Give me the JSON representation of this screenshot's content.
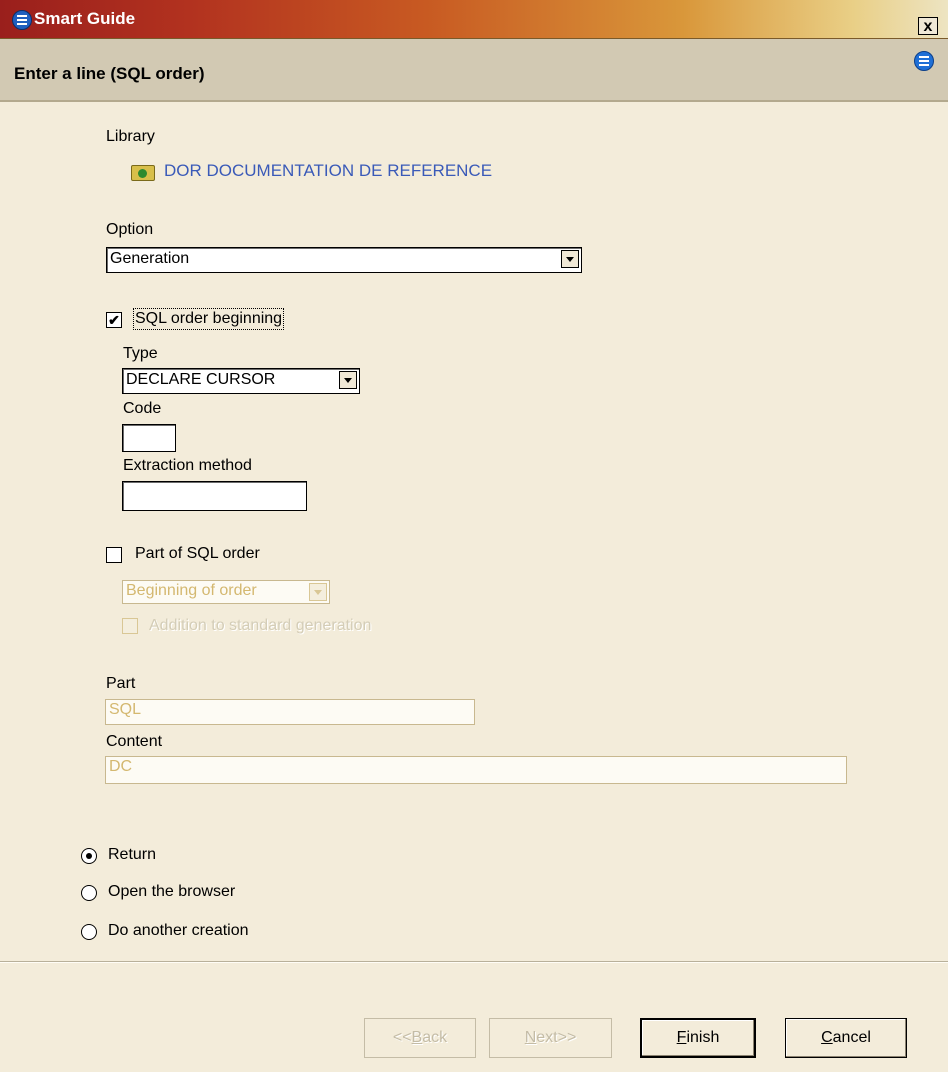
{
  "window": {
    "title": "Smart Guide",
    "close_label": "x"
  },
  "header": {
    "title": "Enter a line (SQL order)"
  },
  "library": {
    "label": "Library",
    "value": "DOR DOCUMENTATION DE REFERENCE"
  },
  "option": {
    "label": "Option",
    "selected": "Generation"
  },
  "sql_order_beginning": {
    "label": "SQL order beginning",
    "checked": true,
    "check_mark": "✔",
    "type_label": "Type",
    "type_selected": "DECLARE CURSOR",
    "code_label": "Code",
    "code_value": "",
    "extraction_label": "Extraction method",
    "extraction_value": ""
  },
  "part_of_sql_order": {
    "label": "Part of SQL order",
    "checked": false,
    "position_selected": "Beginning of order",
    "addition_label": "Addition to standard generation"
  },
  "part": {
    "label": "Part",
    "value": "SQL"
  },
  "content": {
    "label": "Content",
    "value": "DC"
  },
  "after_options": [
    {
      "label": "Return",
      "checked": true
    },
    {
      "label": "Open the browser",
      "checked": false
    },
    {
      "label": "Do another creation",
      "checked": false
    }
  ],
  "buttons": {
    "back": {
      "prefix": "<<",
      "mnemonic": "B",
      "rest": "ack"
    },
    "next": {
      "mnemonic": "N",
      "rest": "ext>>"
    },
    "finish": {
      "mnemonic": "F",
      "rest": "inish"
    },
    "cancel": {
      "mnemonic": "C",
      "rest": "ancel"
    }
  },
  "icons": {
    "app": "smart-guide-icon",
    "help": "help-icon",
    "library": "folder-icon"
  },
  "colors": {
    "titlebar_start": "#9a1f1c",
    "titlebar_end": "#ede4c2",
    "background": "#f3ecda",
    "link": "#3a5ab8"
  }
}
